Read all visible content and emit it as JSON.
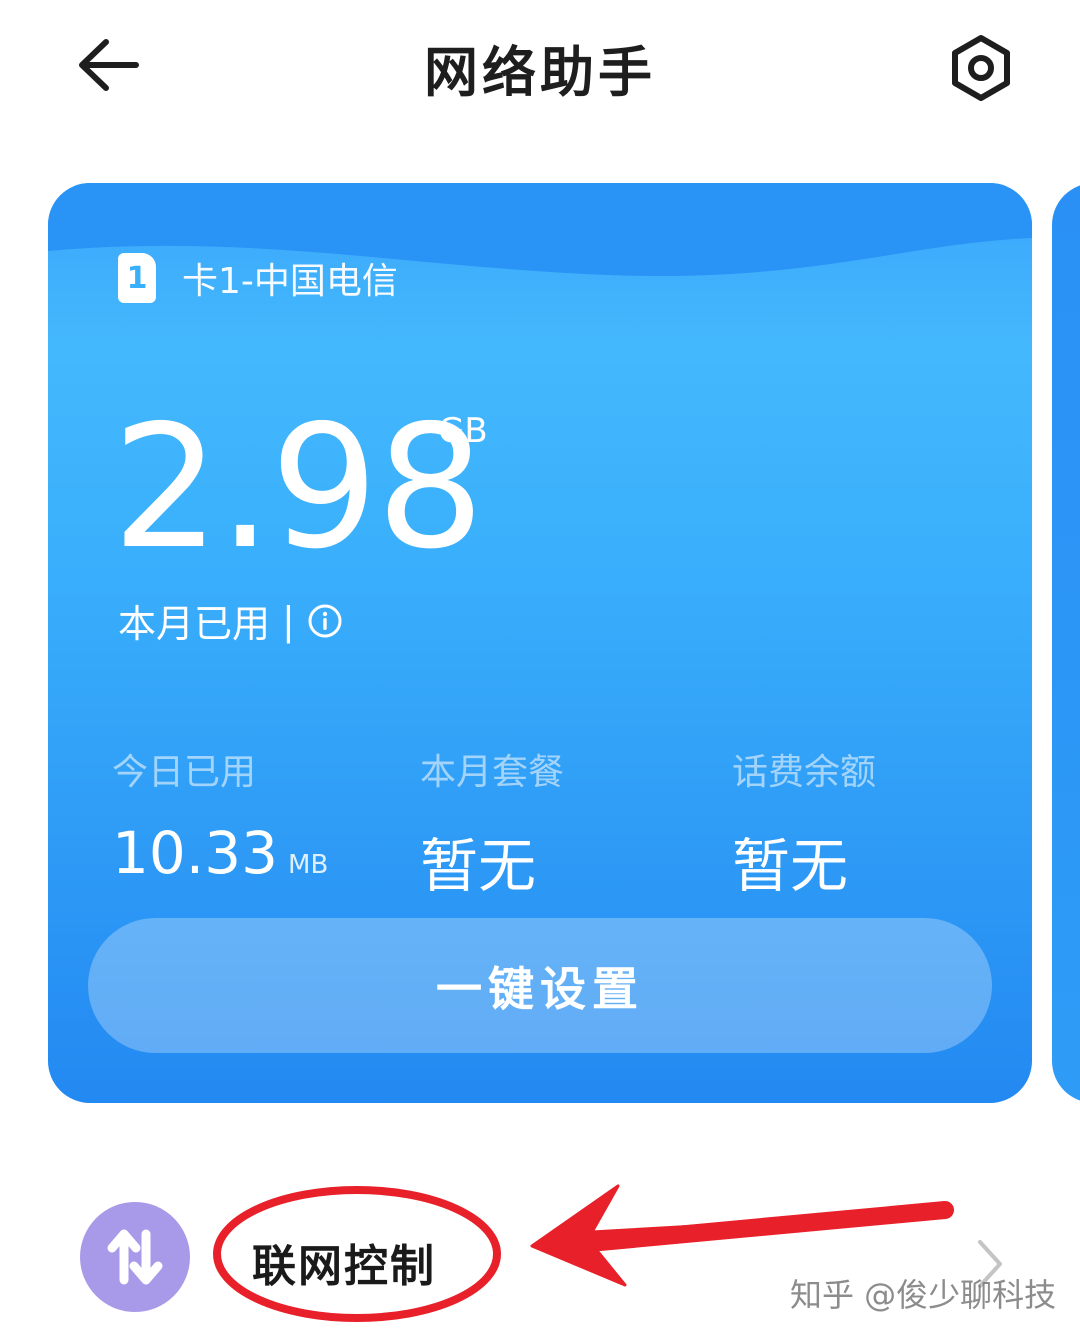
{
  "header": {
    "title": "网络助手"
  },
  "card": {
    "sim_number": "1",
    "sim_label": "卡1-中国电信",
    "used_value": "2.98",
    "used_unit": "GB",
    "used_label": "本月已用",
    "separator": "|",
    "stats": [
      {
        "label": "今日已用",
        "value": "10.33",
        "unit": "MB"
      },
      {
        "label": "本月套餐",
        "value": "暂无",
        "unit": ""
      },
      {
        "label": "话费余额",
        "value": "暂无",
        "unit": ""
      }
    ],
    "setup_button": "一键设置"
  },
  "network_control": {
    "label": "联网控制"
  },
  "watermark": "知乎 @俊少聊科技",
  "colors": {
    "card_blue": "#2f9cf6",
    "icon_purple": "#a99ae9",
    "annotation_red": "#e8202a"
  }
}
